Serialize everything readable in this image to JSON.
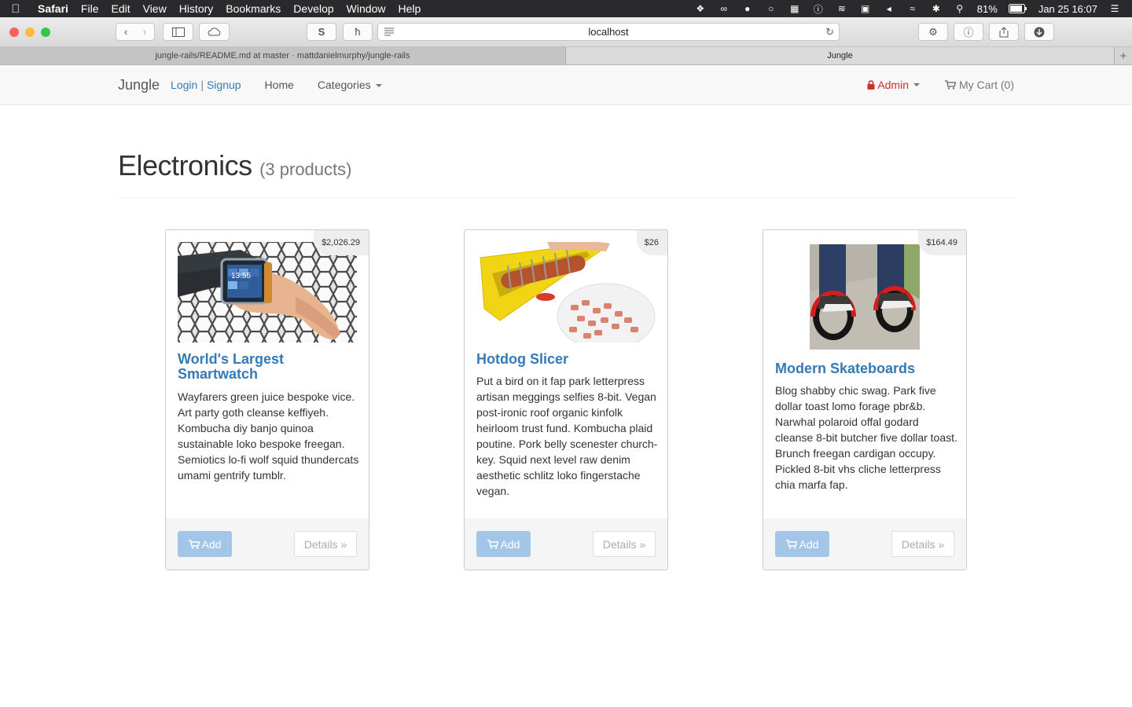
{
  "menubar": {
    "app": "Safari",
    "items": [
      "File",
      "Edit",
      "View",
      "History",
      "Bookmarks",
      "Develop",
      "Window",
      "Help"
    ],
    "battery": "81%",
    "datetime": "Jan 25  16:07"
  },
  "browser": {
    "url": "localhost",
    "tabs": [
      {
        "label": "jungle-rails/README.md at master · mattdanielmurphy/jungle-rails"
      },
      {
        "label": "Jungle"
      }
    ],
    "new_tab": "+"
  },
  "navbar": {
    "brand": "Jungle",
    "login": "Login",
    "separator": "|",
    "signup": "Signup",
    "home": "Home",
    "categories": "Categories",
    "admin": "Admin",
    "cart": "My Cart (0)"
  },
  "page": {
    "title": "Electronics",
    "count": "(3 products)"
  },
  "products": [
    {
      "price": "$2,026.29",
      "name": "World's Largest Smartwatch",
      "description": "Wayfarers green juice bespoke vice. Art party goth cleanse keffiyeh. Kombucha diy banjo quinoa sustainable loko bespoke freegan. Semiotics lo-fi wolf squid thundercats umami gentrify tumblr.",
      "watch_time": "13:55"
    },
    {
      "price": "$26",
      "name": "Hotdog Slicer",
      "description": "Put a bird on it fap park letterpress artisan meggings selfies 8-bit. Vegan post-ironic roof organic kinfolk heirloom trust fund. Kombucha plaid poutine. Pork belly scenester church-key. Squid next level raw denim aesthetic schlitz loko fingerstache vegan."
    },
    {
      "price": "$164.49",
      "name": "Modern Skateboards",
      "description": "Blog shabby chic swag. Park five dollar toast lomo forage pbr&b. Narwhal polaroid offal godard cleanse 8-bit butcher five dollar toast. Brunch freegan cardigan occupy. Pickled 8-bit vhs cliche letterpress chia marfa fap."
    }
  ],
  "buttons": {
    "add": "Add",
    "details": "Details »"
  },
  "colors": {
    "link": "#337ab7",
    "admin": "#c9302c",
    "add_button": "#a3c6e8"
  }
}
